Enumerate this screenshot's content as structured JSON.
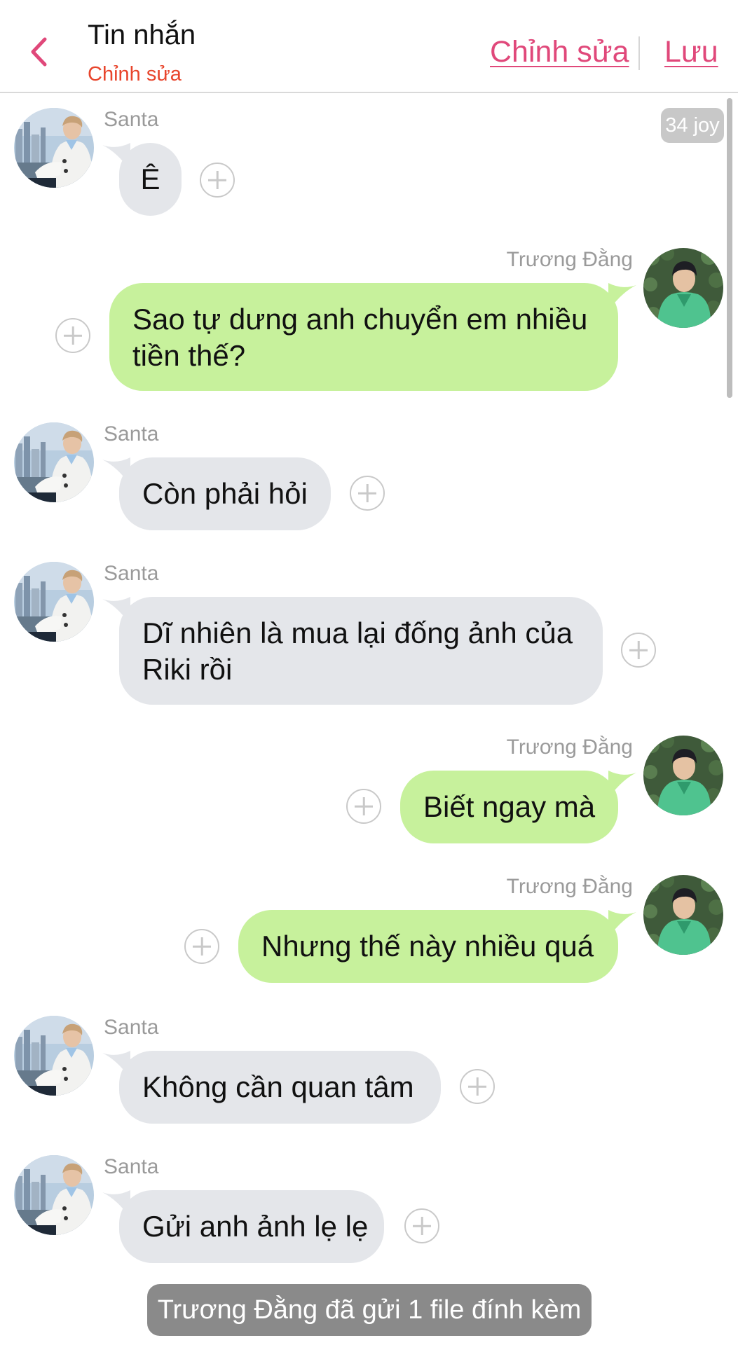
{
  "header": {
    "title": "Tin nhắn",
    "subtitle": "Chỉnh sửa",
    "edit_label": "Chỉnh sửa",
    "save_label": "Lưu",
    "back_icon": "chevron-left-icon",
    "accent_color": "#e0487a",
    "subtitle_color": "#e8452c"
  },
  "joy_badge": "34 joy",
  "colors": {
    "incoming_bubble": "#e4e6ea",
    "outgoing_bubble": "#c7f19c",
    "sender_name": "#9a9a9a",
    "notice_bg": "#8a8a8a"
  },
  "messages": [
    {
      "side": "left",
      "sender": "Santa",
      "text": "Ê",
      "avatar": "santa-avatar"
    },
    {
      "side": "right",
      "sender": "Trương Đằng",
      "text": "Sao tự dưng anh chuyển em nhiều tiền thế?",
      "avatar": "truong-dang-avatar"
    },
    {
      "side": "left",
      "sender": "Santa",
      "text": "Còn phải hỏi",
      "avatar": "santa-avatar"
    },
    {
      "side": "left",
      "sender": "Santa",
      "text": "Dĩ nhiên là mua lại đống ảnh của Riki rồi",
      "avatar": "santa-avatar"
    },
    {
      "side": "right",
      "sender": "Trương Đằng",
      "text": "Biết ngay mà",
      "avatar": "truong-dang-avatar"
    },
    {
      "side": "right",
      "sender": "Trương Đằng",
      "text": "Nhưng thế này nhiều quá",
      "avatar": "truong-dang-avatar"
    },
    {
      "side": "left",
      "sender": "Santa",
      "text": "Không cần quan tâm",
      "avatar": "santa-avatar"
    },
    {
      "side": "left",
      "sender": "Santa",
      "text": "Gửi anh ảnh lẹ lẹ",
      "avatar": "santa-avatar"
    }
  ],
  "notice": "Trương Đằng đã gửi 1 file đính kèm"
}
